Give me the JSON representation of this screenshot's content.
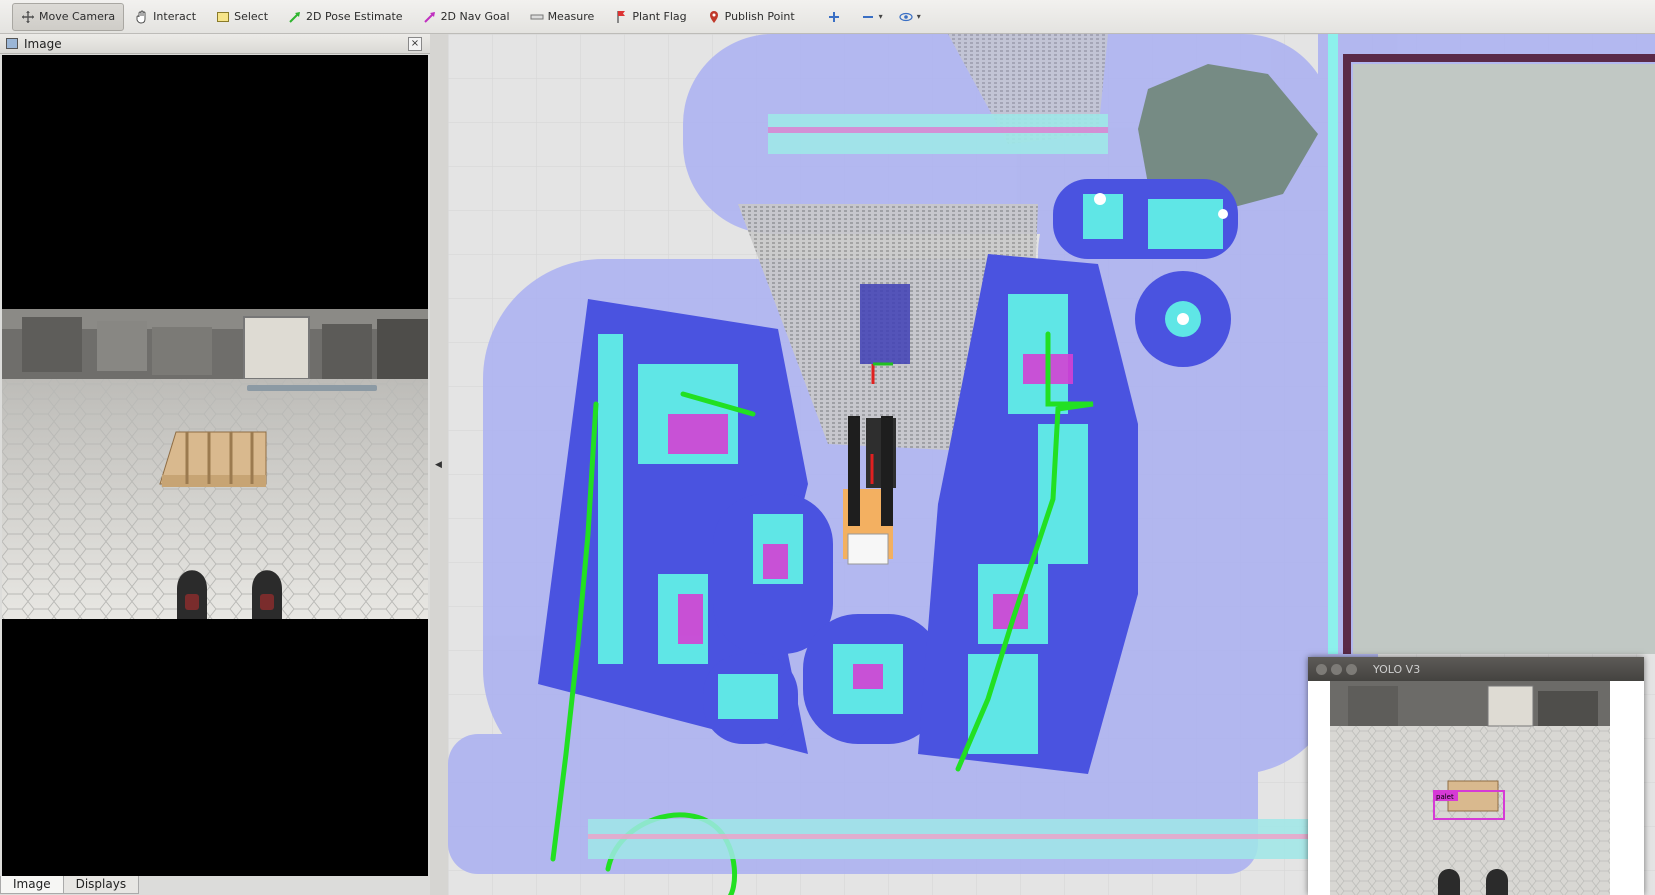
{
  "toolbar": {
    "tools": [
      {
        "label": "Move Camera",
        "icon": "move-camera-icon",
        "active": true
      },
      {
        "label": "Interact",
        "icon": "hand-icon",
        "active": false
      },
      {
        "label": "Select",
        "icon": "select-icon",
        "active": false
      },
      {
        "label": "2D Pose Estimate",
        "icon": "pose-arrow-icon",
        "active": false
      },
      {
        "label": "2D Nav Goal",
        "icon": "nav-goal-arrow-icon",
        "active": false
      },
      {
        "label": "Measure",
        "icon": "ruler-icon",
        "active": false
      },
      {
        "label": "Plant Flag",
        "icon": "flag-icon",
        "active": false
      },
      {
        "label": "Publish Point",
        "icon": "map-pin-icon",
        "active": false
      }
    ],
    "extra_icons": [
      "plus-icon",
      "minus-icon",
      "eye-icon"
    ]
  },
  "left_panel": {
    "title": "Image",
    "tabs": [
      "Image",
      "Displays"
    ],
    "active_tab": "Image"
  },
  "yolo_window": {
    "title": "YOLO V3",
    "detection_label": "palet"
  },
  "colors": {
    "costmap_blue": "#4a53e0",
    "costmap_cyan": "#5fe6e6",
    "costmap_magenta": "#d440d4",
    "path_green": "#22e022",
    "inflation_lavender": "#aab0f2"
  }
}
